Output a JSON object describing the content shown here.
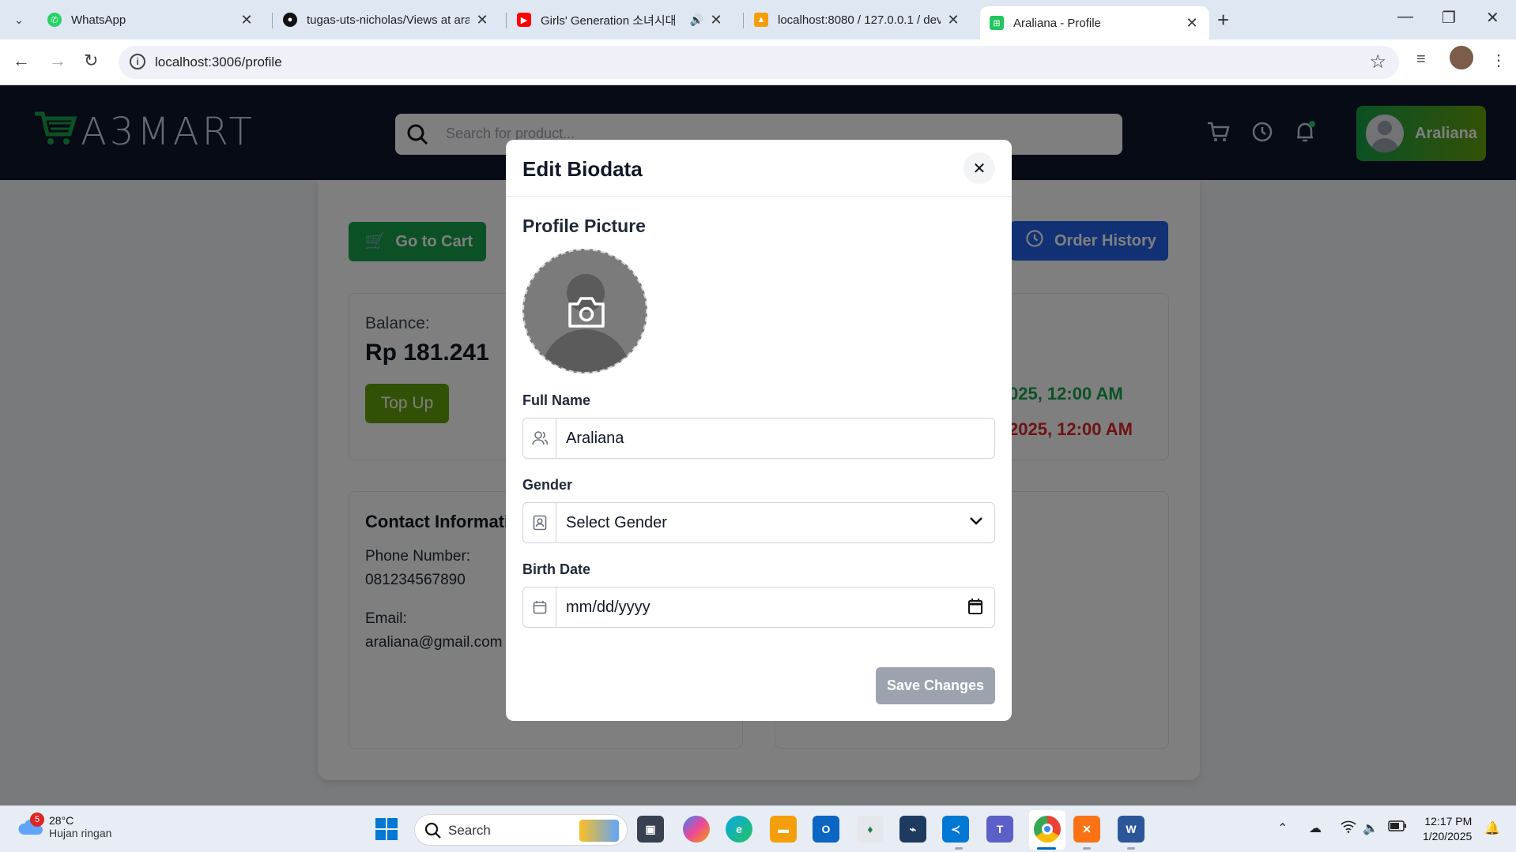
{
  "browser": {
    "tabs": [
      {
        "title": "WhatsApp",
        "favicon": "whatsapp-icon"
      },
      {
        "title": "tugas-uts-nicholas/Views at ara",
        "favicon": "github-icon"
      },
      {
        "title": "Girls' Generation 소녀시대 ",
        "favicon": "youtube-icon"
      },
      {
        "title": "localhost:8080 / 127.0.0.1 / dev",
        "favicon": "phpmyadmin-icon"
      },
      {
        "title": "Araliana - Profile",
        "favicon": "a3mart-icon"
      }
    ],
    "url": "localhost:3006/profile"
  },
  "header": {
    "logo_text": "A3MART",
    "search_placeholder": "Search for product...",
    "user_name": "Araliana"
  },
  "page": {
    "go_to_cart": "Go to Cart",
    "order_history": "Order History",
    "balance_label": "Balance:",
    "balance_value": "Rp 181.241",
    "top_up": "Top Up",
    "date_green": "025, 12:00 AM",
    "date_red": "2025, 12:00 AM",
    "contact_title": "Contact Informati",
    "phone_label": "Phone Number:",
    "phone_value": "081234567890",
    "email_label": "Email:",
    "email_value": "araliana@gmail.com"
  },
  "modal": {
    "title": "Edit Biodata",
    "profile_picture_label": "Profile Picture",
    "full_name_label": "Full Name",
    "full_name_value": "Araliana",
    "gender_label": "Gender",
    "gender_value": "Select Gender",
    "birth_date_label": "Birth Date",
    "birth_date_value": "mm/dd/yyyy",
    "save_button": "Save Changes"
  },
  "taskbar": {
    "temperature": "28°C",
    "weather": "Hujan ringan",
    "weather_badge": "5",
    "search_label": "Search",
    "time": "12:17 PM",
    "date": "1/20/2025"
  },
  "colors": {
    "accent_green": "#16a34a",
    "accent_blue": "#2563eb",
    "header_bg": "#0f172a"
  }
}
